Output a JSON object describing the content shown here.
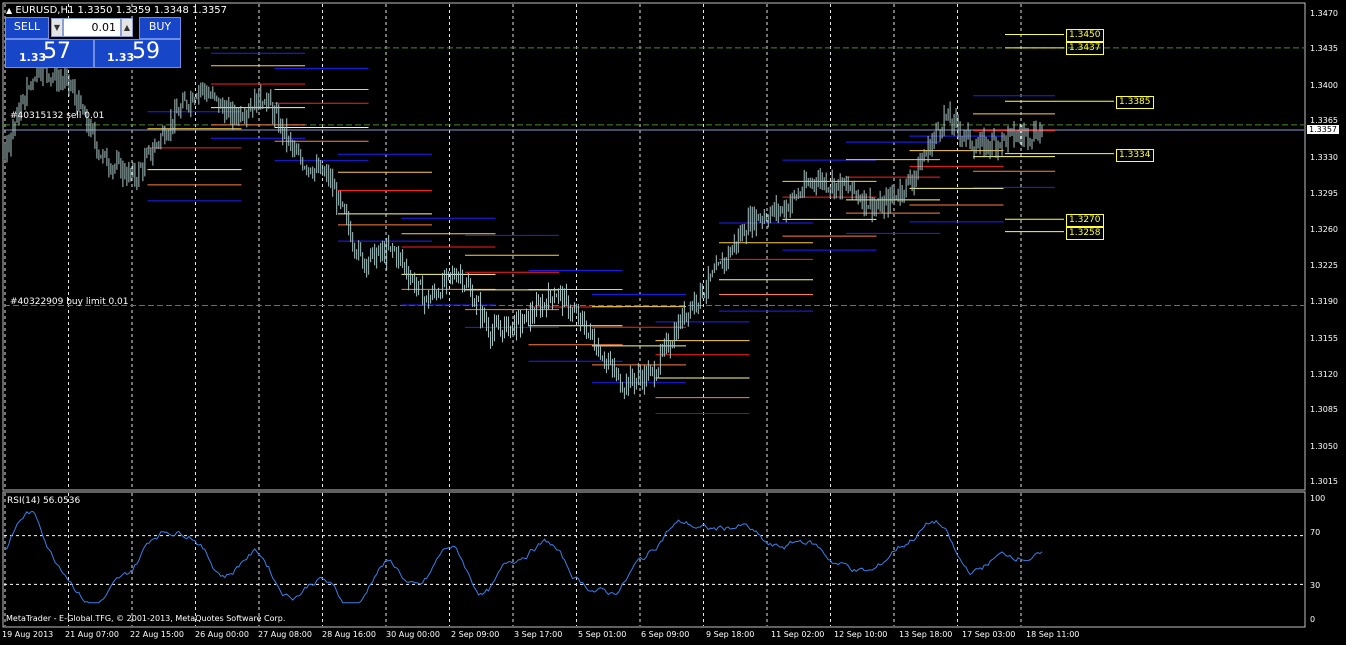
{
  "window": {
    "symbol_header": "EURUSD,H1  1.3350 1.3359 1.3348 1.3357",
    "copyright": "MetaTrader - E-Global.TFG, © 2001-2013, MetaQuotes Software Corp."
  },
  "trade_panel": {
    "sell_label": "SELL",
    "buy_label": "BUY",
    "lot_value": "0.01",
    "sell_price_small": "1.33",
    "sell_price_big": "57",
    "buy_price_small": "1.33",
    "buy_price_big": "59"
  },
  "orders": [
    {
      "label": "#40315132 sell 0.01",
      "price": 1.3362
    },
    {
      "label": "#40322909 buy limit 0.01",
      "price": 1.3186
    }
  ],
  "price_axis": {
    "ticks": [
      "1.3470",
      "1.3435",
      "1.3400",
      "1.3365",
      "1.3330",
      "1.3295",
      "1.3260",
      "1.3225",
      "1.3190",
      "1.3155",
      "1.3120",
      "1.3085",
      "1.3050",
      "1.3015"
    ],
    "current_price": "1.3357"
  },
  "level_labels": [
    "1.3450",
    "1.3437",
    "1.3385",
    "1.3334",
    "1.3270",
    "1.3258"
  ],
  "rsi": {
    "label": "RSI(14) 56.0536",
    "ticks": [
      "100",
      "70",
      "30",
      "0"
    ]
  },
  "time_axis": {
    "labels": [
      "19 Aug 2013",
      "21 Aug 07:00",
      "22 Aug 15:00",
      "26 Aug 00:00",
      "27 Aug 08:00",
      "28 Aug 16:00",
      "30 Aug 00:00",
      "2 Sep 09:00",
      "3 Sep 17:00",
      "5 Sep 01:00",
      "6 Sep 09:00",
      "9 Sep 18:00",
      "11 Sep 02:00",
      "12 Sep 10:00",
      "13 Sep 18:00",
      "17 Sep 03:00",
      "18 Sep 11:00"
    ]
  },
  "colors": {
    "candles": "#a9c4c4",
    "grid": "#ffffff",
    "order_line": "#4a8a2a",
    "rsi_line": "#3a7fe8",
    "level_label_bg": "#000000",
    "level_label_border": "#ffff40"
  },
  "chart_data": {
    "type": "line",
    "title": "EURUSD,H1",
    "series": [
      {
        "name": "EURUSD,H1",
        "values": [
          1.334,
          1.342,
          1.34,
          1.333,
          1.331,
          1.336,
          1.34,
          1.337,
          1.339,
          1.333,
          1.331,
          1.323,
          1.324,
          1.319,
          1.322,
          1.316,
          1.317,
          1.32,
          1.316,
          1.311,
          1.312,
          1.318,
          1.322,
          1.327,
          1.328,
          1.331,
          1.33,
          1.328,
          1.331,
          1.337,
          1.334,
          1.335,
          1.3357
        ]
      }
    ],
    "ylim": [
      1.3,
      1.348
    ]
  }
}
